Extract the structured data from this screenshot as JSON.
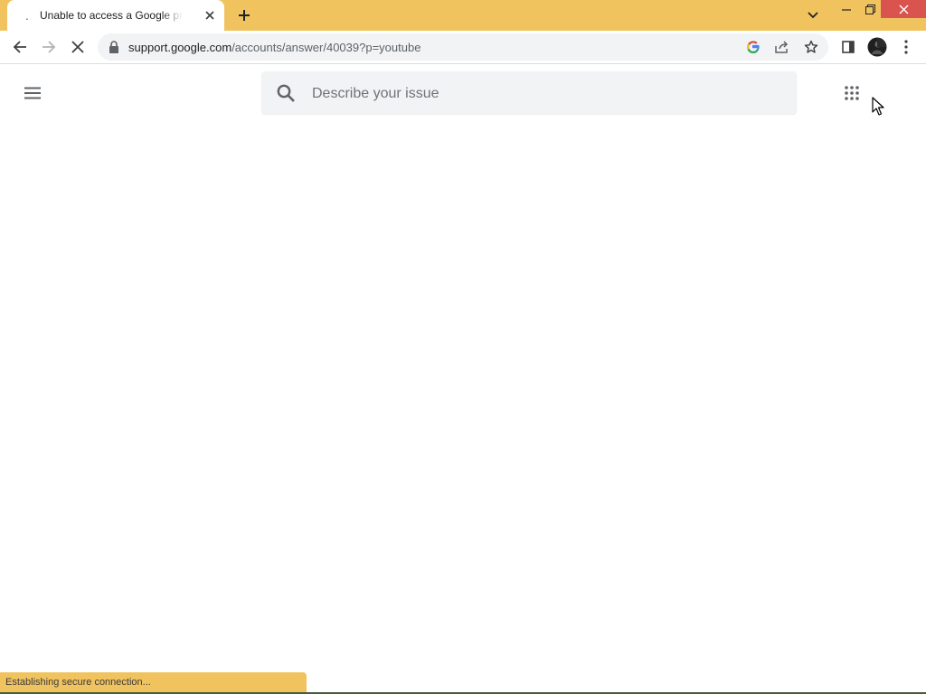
{
  "tab": {
    "title": "Unable to access a Google product",
    "spinner_glyph": "."
  },
  "toolbar": {
    "url_host": "support.google.com",
    "url_path": "/accounts/answer/40039?p=youtube"
  },
  "page": {
    "search_placeholder": "Describe your issue"
  },
  "status_bar": {
    "text": "Establishing secure connection..."
  },
  "colors": {
    "frame": "#f0c35f",
    "close_button": "#d9534f",
    "omnibox": "#f1f3f4"
  },
  "icons": [
    "close-icon",
    "plus-icon",
    "chevron-down-icon",
    "minimize-icon",
    "restore-icon",
    "back-arrow-icon",
    "forward-arrow-icon",
    "stop-loading-icon",
    "lock-icon",
    "google-g-icon",
    "share-icon",
    "star-icon",
    "side-panel-icon",
    "avatar",
    "more-vert-icon",
    "hamburger-menu-icon",
    "search-icon",
    "apps-grid-icon",
    "mouse-cursor"
  ]
}
